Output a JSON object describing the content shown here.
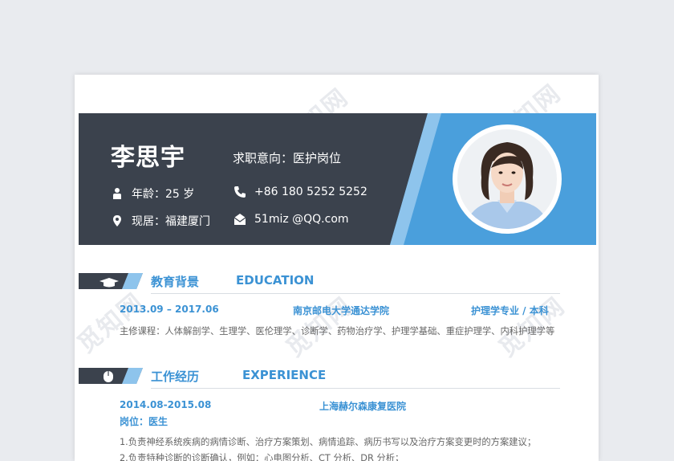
{
  "header": {
    "name": "李思宇",
    "intent": "求职意向：医护岗位",
    "age": "年龄：25 岁",
    "address": "现居：福建厦门",
    "phone": "+86 180 5252 5252",
    "email": "51miz @QQ.com"
  },
  "education": {
    "title_cn": "教育背景",
    "title_en": "EDUCATION",
    "period": "2013.09  –  2017.06",
    "school": "南京邮电大学通达学院",
    "major": "护理学专业 / 本科",
    "courses": "主修课程：人体解剖学、生理学、医伦理学、诊断学、药物治疗学、护理学基础、重症护理学、内科护理学等"
  },
  "experience": {
    "title_cn": "工作经历",
    "title_en": "EXPERIENCE",
    "period": "2014.08-2015.08",
    "company": "上海赫尔森康复医院",
    "position": "岗位：医生",
    "duty_1": "1.负责神经系统疾病的病情诊断、治疗方案策划、病情追踪、病历书写以及治疗方案变更时的方案建议；",
    "duty_2": "2.负责特种诊断的诊断确认，例如：心电图分析、CT 分析、DR 分析；"
  },
  "watermark": "觅知网",
  "colors": {
    "dark": "#3b424d",
    "blue": "#4a9fdc",
    "light_blue": "#8ec4ec",
    "accent_text": "#3b92d4"
  },
  "icons": [
    "person-icon",
    "location-icon",
    "phone-icon",
    "mail-icon",
    "graduation-cap-icon",
    "mouse-icon"
  ]
}
